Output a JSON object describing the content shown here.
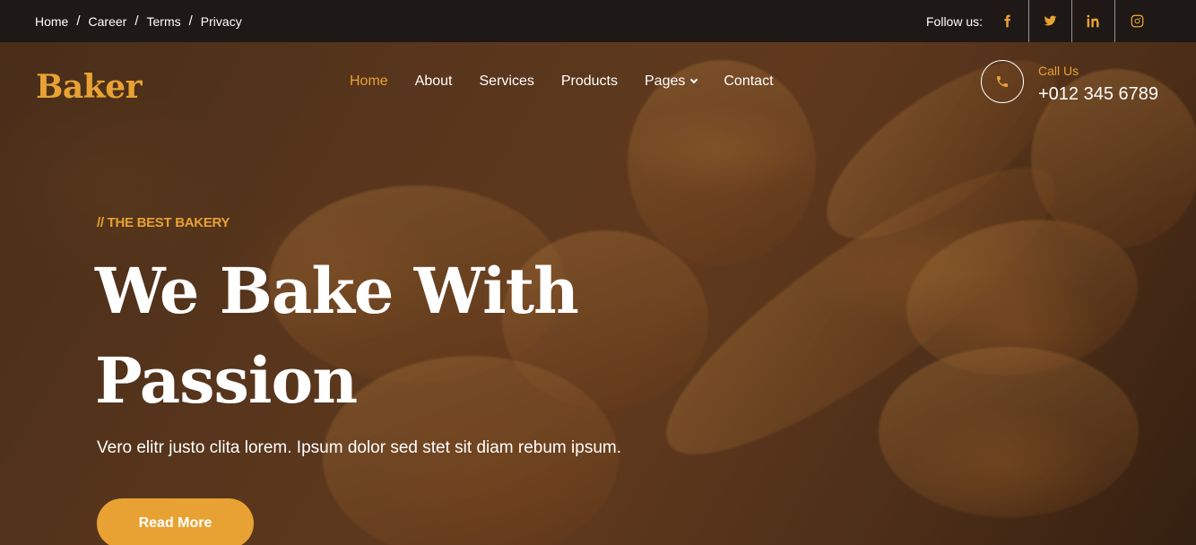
{
  "topbar": {
    "links": [
      "Home",
      "Career",
      "Terms",
      "Privacy"
    ],
    "follow_label": "Follow us:",
    "socials": [
      "facebook-icon",
      "twitter-icon",
      "linkedin-icon",
      "instagram-icon"
    ]
  },
  "brand": "Baker",
  "nav": {
    "items": [
      "Home",
      "About",
      "Services",
      "Products",
      "Pages",
      "Contact"
    ],
    "active": "Home"
  },
  "contact": {
    "label": "Call Us",
    "phone": "+012 345 6789"
  },
  "hero": {
    "eyebrow": "// THE BEST BAKERY",
    "headline_line1": "We Bake With",
    "headline_line2": "Passion",
    "lead": "Vero elitr justo clita lorem. Ipsum dolor sed stet sit diam rebum ipsum.",
    "cta": "Read More"
  },
  "colors": {
    "accent": "#e8a233",
    "topbar": "#1e1816"
  }
}
